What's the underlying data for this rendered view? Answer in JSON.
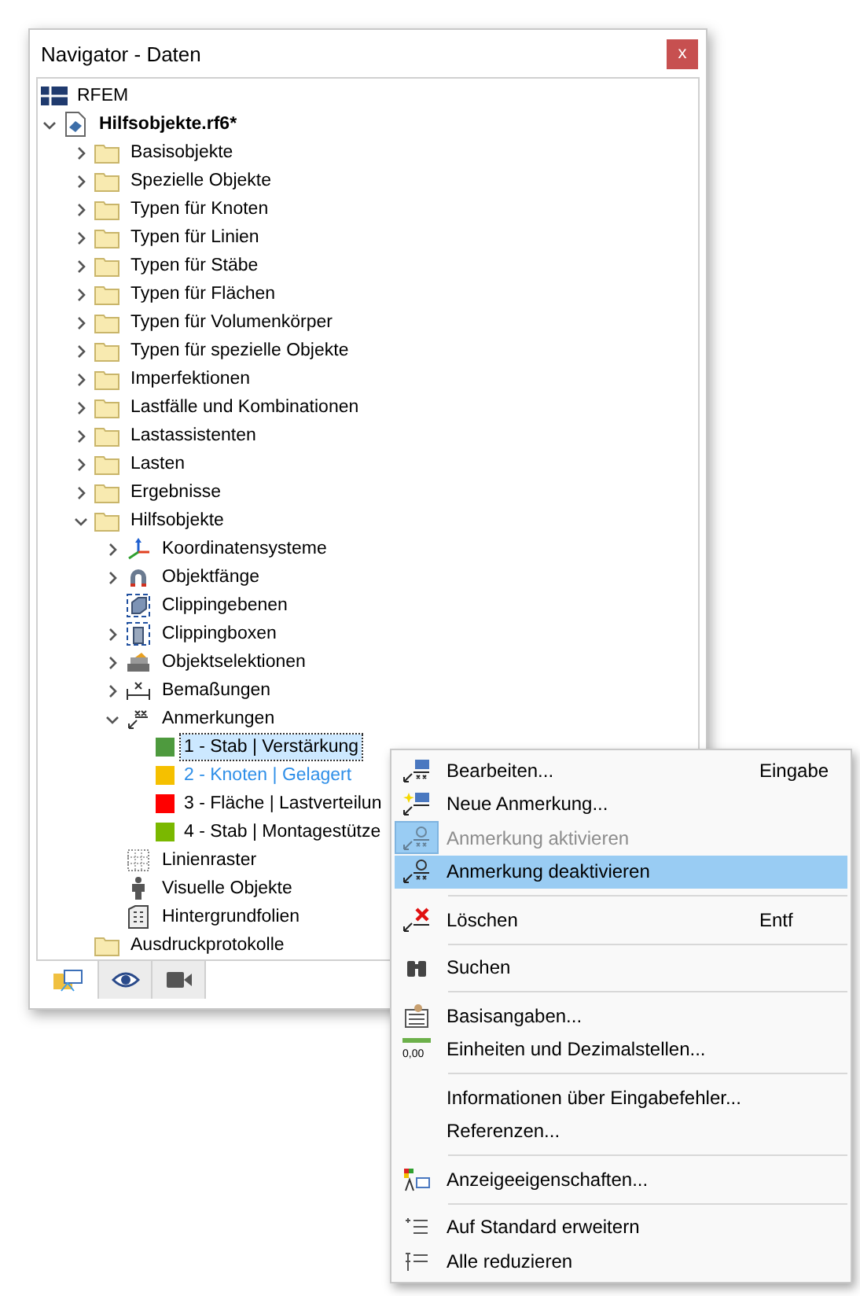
{
  "window": {
    "title": "Navigator - Daten",
    "close": "x"
  },
  "tree": [
    {
      "label": "RFEM",
      "kind": "root"
    },
    {
      "label": "Hilfsobjekte.rf6*",
      "kind": "file",
      "expanded": true,
      "children": [
        {
          "label": "Basisobjekte",
          "kind": "folder",
          "expanded": false
        },
        {
          "label": "Spezielle Objekte",
          "kind": "folder",
          "expanded": false
        },
        {
          "label": "Typen für Knoten",
          "kind": "folder",
          "expanded": false
        },
        {
          "label": "Typen für Linien",
          "kind": "folder",
          "expanded": false
        },
        {
          "label": "Typen für Stäbe",
          "kind": "folder",
          "expanded": false
        },
        {
          "label": "Typen für Flächen",
          "kind": "folder",
          "expanded": false
        },
        {
          "label": "Typen für Volumenkörper",
          "kind": "folder",
          "expanded": false
        },
        {
          "label": "Typen für spezielle Objekte",
          "kind": "folder",
          "expanded": false
        },
        {
          "label": "Imperfektionen",
          "kind": "folder",
          "expanded": false
        },
        {
          "label": "Lastfälle und Kombinationen",
          "kind": "folder",
          "expanded": false
        },
        {
          "label": "Lastassistenten",
          "kind": "folder",
          "expanded": false
        },
        {
          "label": "Lasten",
          "kind": "folder",
          "expanded": false
        },
        {
          "label": "Ergebnisse",
          "kind": "folder",
          "expanded": false
        },
        {
          "label": "Hilfsobjekte",
          "kind": "folder",
          "expanded": true,
          "children": [
            {
              "label": "Koordinatensysteme",
              "kind": "axes",
              "expanded": false
            },
            {
              "label": "Objektfänge",
              "kind": "magnet",
              "expanded": false
            },
            {
              "label": "Clippingebenen",
              "kind": "plane"
            },
            {
              "label": "Clippingboxen",
              "kind": "box",
              "expanded": false
            },
            {
              "label": "Objektselektionen",
              "kind": "selection",
              "expanded": false
            },
            {
              "label": "Bemaßungen",
              "kind": "dimension",
              "expanded": false
            },
            {
              "label": "Anmerkungen",
              "kind": "annotation",
              "expanded": true,
              "children": [
                {
                  "label": "1 - Stab | Verstärkung",
                  "kind": "swatch",
                  "color": "#4e9a3e",
                  "selected": true,
                  "highlighted": false
                },
                {
                  "label": "2 - Knoten | Gelagert",
                  "kind": "swatch",
                  "color": "#f5c000",
                  "selected": false,
                  "highlighted": true
                },
                {
                  "label": "3 - Fläche | Lastverteilun",
                  "kind": "swatch",
                  "color": "#ff0000",
                  "selected": false,
                  "highlighted": false
                },
                {
                  "label": "4 - Stab | Montagestütze",
                  "kind": "swatch",
                  "color": "#7ab800",
                  "selected": false,
                  "highlighted": false
                }
              ]
            },
            {
              "label": "Linienraster",
              "kind": "grid"
            },
            {
              "label": "Visuelle Objekte",
              "kind": "figure"
            },
            {
              "label": "Hintergrundfolien",
              "kind": "building"
            }
          ]
        },
        {
          "label": "Ausdruckprotokolle",
          "kind": "folder"
        }
      ]
    }
  ],
  "tabs": [
    {
      "kind": "data",
      "selected": true
    },
    {
      "kind": "view",
      "selected": false
    },
    {
      "kind": "camera",
      "selected": false
    }
  ],
  "context_menu": {
    "groups": [
      [
        {
          "label": "Bearbeiten...",
          "shortcut": "Eingabe",
          "kind": "edit",
          "disabled": false,
          "checked": false,
          "highlighted": false
        },
        {
          "label": "Neue Anmerkung...",
          "kind": "new",
          "disabled": false,
          "checked": false,
          "highlighted": false
        },
        {
          "label": "Anmerkung aktivieren",
          "kind": "toggle",
          "disabled": true,
          "checked": true,
          "highlighted": false
        },
        {
          "label": "Anmerkung deaktivieren",
          "kind": "toggle",
          "disabled": false,
          "checked": false,
          "highlighted": true
        }
      ],
      [
        {
          "label": "Löschen",
          "shortcut": "Entf",
          "kind": "delete",
          "disabled": false,
          "checked": false,
          "highlighted": false
        }
      ],
      [
        {
          "label": "Suchen",
          "kind": "find",
          "disabled": false,
          "checked": false,
          "highlighted": false
        }
      ],
      [
        {
          "label": "Basisangaben...",
          "kind": "basic",
          "disabled": false,
          "checked": false,
          "highlighted": false
        },
        {
          "label": "Einheiten und Dezimalstellen...",
          "kind": "units",
          "icon_text": "0,00",
          "disabled": false,
          "checked": false,
          "highlighted": false
        }
      ],
      [
        {
          "label": "Informationen über Eingabefehler...",
          "kind": "plain",
          "disabled": false,
          "checked": false,
          "highlighted": false
        },
        {
          "label": "Referenzen...",
          "kind": "plain",
          "disabled": false,
          "checked": false,
          "highlighted": false
        }
      ],
      [
        {
          "label": "Anzeigeeigenschaften...",
          "kind": "display",
          "disabled": false,
          "checked": false,
          "highlighted": false
        }
      ],
      [
        {
          "label": "Auf Standard erweitern",
          "kind": "expand",
          "disabled": false,
          "checked": false,
          "highlighted": false
        },
        {
          "label": "Alle reduzieren",
          "kind": "collapse",
          "disabled": false,
          "checked": false,
          "highlighted": false
        }
      ]
    ]
  }
}
